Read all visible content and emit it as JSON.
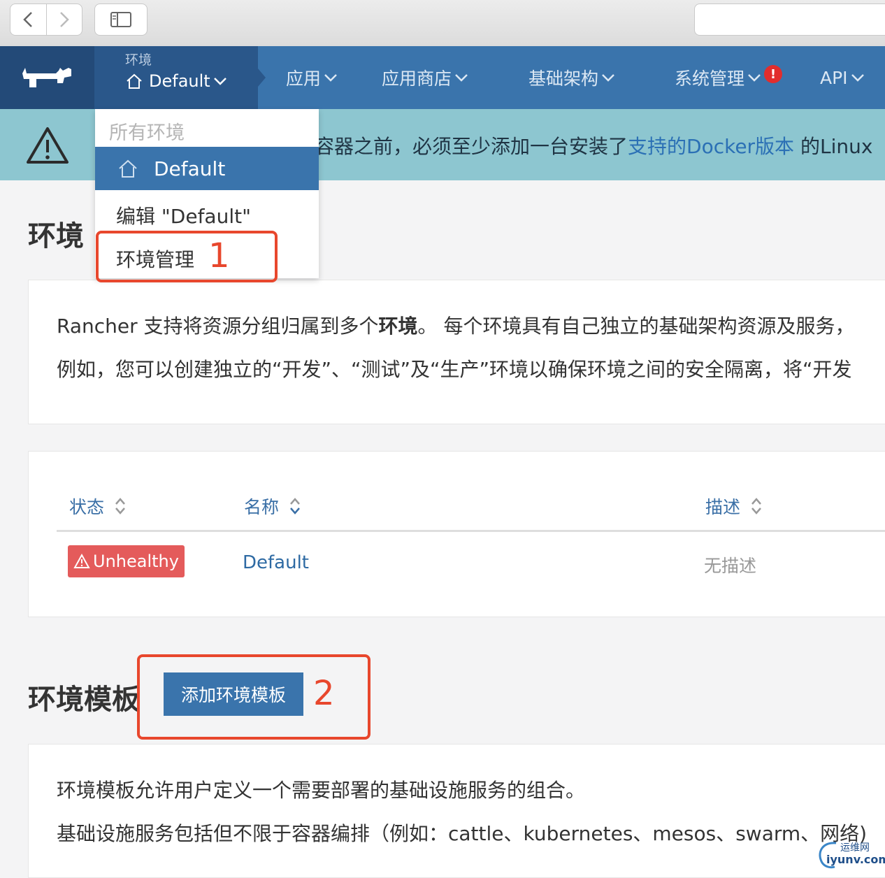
{
  "browser": {
    "back_icon": "chevron-left-icon",
    "forward_icon": "chevron-right-icon",
    "sidebar_icon": "sidebar-icon"
  },
  "header": {
    "logo_icon": "rancher-logo-icon",
    "env_caption": "环境",
    "env_current": "Default",
    "menus": [
      {
        "label": "应用"
      },
      {
        "label": "应用商店"
      },
      {
        "label": "基础架构"
      },
      {
        "label": "系统管理",
        "alert": "!"
      },
      {
        "label": "API"
      }
    ]
  },
  "banner": {
    "icon": "warning-triangle-icon",
    "text_before": "容器之前，必须至少添加一台安装了",
    "link": "支持的Docker版本",
    "text_after": " 的Linux"
  },
  "dropdown": {
    "header": "所有环境",
    "active": "Default",
    "edit": "编辑 \"Default\"",
    "manage": "环境管理"
  },
  "environments": {
    "heading": "环境",
    "intro_line1_pre": "Rancher 支持将资源分组归属到多个",
    "intro_line1_bold": "环境",
    "intro_line1_post": "。 每个环境具有自己独立的基础架构资源及服务，",
    "intro_line2": "例如，您可以创建独立的“开发”、“测试”及“生产”环境以确保环境之间的安全隔离，将“开发",
    "table": {
      "columns": [
        "状态",
        "名称",
        "描述"
      ],
      "rows": [
        {
          "status": "Unhealthy",
          "name": "Default",
          "description": "无描述"
        }
      ]
    }
  },
  "templates": {
    "heading": "环境模板",
    "add_button": "添加环境模板",
    "desc_line1": "环境模板允许用户定义一个需要部署的基础设施服务的组合。",
    "desc_line2": "基础设施服务包括但不限于容器编排（例如：cattle、kubernetes、mesos、swarm、网络)"
  },
  "annotations": {
    "step1": "1",
    "step2": "2",
    "color": "#e8472d"
  },
  "watermark": {
    "top": "运维网",
    "bottom": "iyunv.com"
  },
  "colors": {
    "nav": "#3a74ac",
    "nav_dark": "#234a78",
    "banner": "#8dc6d0",
    "danger": "#e45b5b"
  }
}
